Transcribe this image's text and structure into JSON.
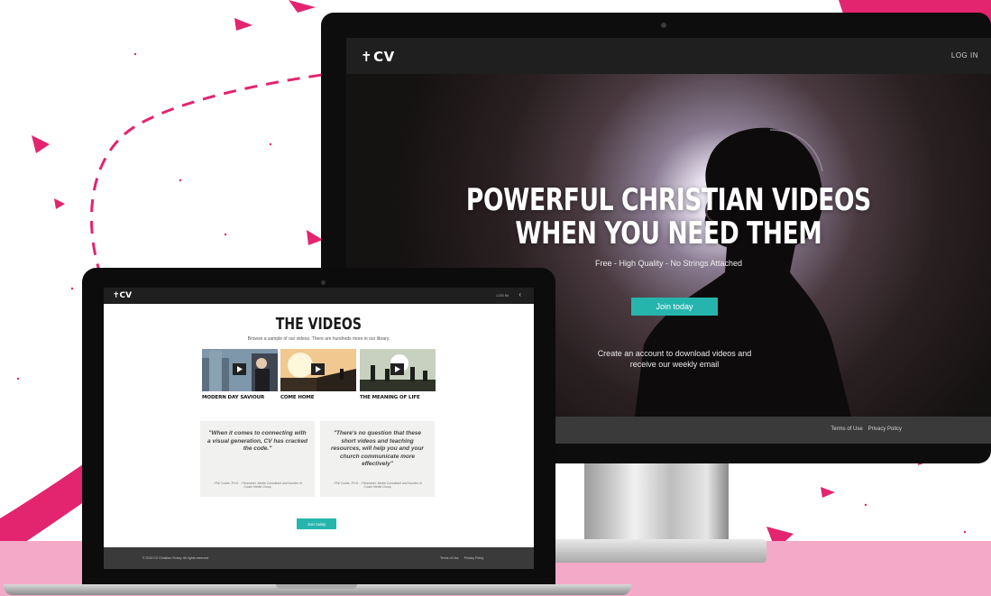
{
  "colors": {
    "accent": "#26b5ad",
    "brand_pink": "#e3246f",
    "floor_pink": "#f5a9c8",
    "nav_dark": "#1f1f1f",
    "footer_dark": "#3a3a3a"
  },
  "monitor_site": {
    "nav": {
      "logo_mark": "✝",
      "logo_text": "CV",
      "login_label": "LOG IN"
    },
    "hero": {
      "title_line1": "POWERFUL CHRISTIAN VIDEOS",
      "title_line2": "WHEN YOU NEED THEM",
      "subtitle": "Free - High Quality - No Strings Attached",
      "join_label": "Join today",
      "caption": "Create an account to download videos and receive our weekly email"
    },
    "footer": {
      "terms_label": "Terms of Use",
      "privacy_label": "Privacy Policy"
    }
  },
  "laptop_site": {
    "nav": {
      "logo_mark": "✝",
      "logo_text": "CV",
      "login_label": "LOG IN",
      "arrow_icon": "chevron-left-icon"
    },
    "heading": "THE VIDEOS",
    "intro": "Browse a sample of our videos. There are hundreds more in our library.",
    "videos": [
      {
        "title": "MODERN DAY SAVIOUR",
        "play_icon": "play-icon"
      },
      {
        "title": "COME HOME",
        "play_icon": "play-icon"
      },
      {
        "title": "THE MEANING OF LIFE",
        "play_icon": "play-icon"
      }
    ],
    "quotes": [
      {
        "text": "\"When it comes to connecting with a visual generation, CV has cracked the code.\"",
        "author": "- Phil Cooke, Ph.D. - Filmmaker, Media Consultant and founder of Cooke Media Group"
      },
      {
        "text": "\"There's no question that these short videos and teaching resources, will help you and your church communicate more effectively\"",
        "author": "- Phil Cooke, Ph.D. - Filmmaker, Media Consultant and founder of Cooke Media Group"
      }
    ],
    "join_label": "Join today",
    "footer": {
      "copyright": "© 2019 CV Christian Victory. All rights reserved",
      "terms_label": "Terms of Use",
      "privacy_label": "Privacy Policy"
    }
  }
}
